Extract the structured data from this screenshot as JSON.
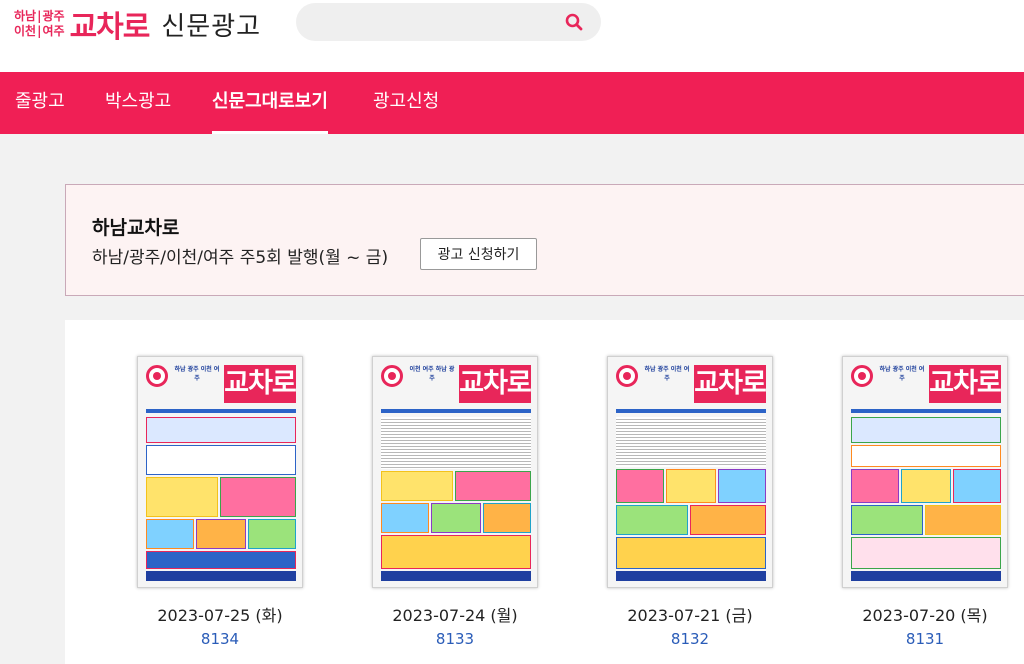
{
  "header": {
    "logo": {
      "regions": [
        "하남",
        "광주",
        "이천",
        "여주"
      ],
      "brand": "교차로",
      "subtitle": "신문광고"
    },
    "search": {
      "placeholder": "",
      "icon": "search-icon"
    }
  },
  "nav": {
    "items": [
      {
        "label": "줄광고"
      },
      {
        "label": "박스광고"
      },
      {
        "label": "신문그대로보기",
        "active": true
      },
      {
        "label": "광고신청"
      }
    ]
  },
  "info": {
    "title": "하남교차로",
    "description": "하남/광주/이천/여주 주5회 발행(월 ~ 금)",
    "button_label": "광고 신청하기"
  },
  "issues": [
    {
      "date": "2023-07-25 (화)",
      "number": "8134",
      "masthead": "교차로",
      "regions": "하남 광주 이천 여주"
    },
    {
      "date": "2023-07-24 (월)",
      "number": "8133",
      "masthead": "교차로",
      "regions": "이천 여주 하남 광주"
    },
    {
      "date": "2023-07-21 (금)",
      "number": "8132",
      "masthead": "교차로",
      "regions": "하남 광주 이천 여주"
    },
    {
      "date": "2023-07-20 (목)",
      "number": "8131",
      "masthead": "교차로",
      "regions": "하남 광주 이천 여주"
    }
  ],
  "colors": {
    "brand": "#e8265a",
    "nav_bg": "#f01f55",
    "link": "#2a5cb8"
  }
}
